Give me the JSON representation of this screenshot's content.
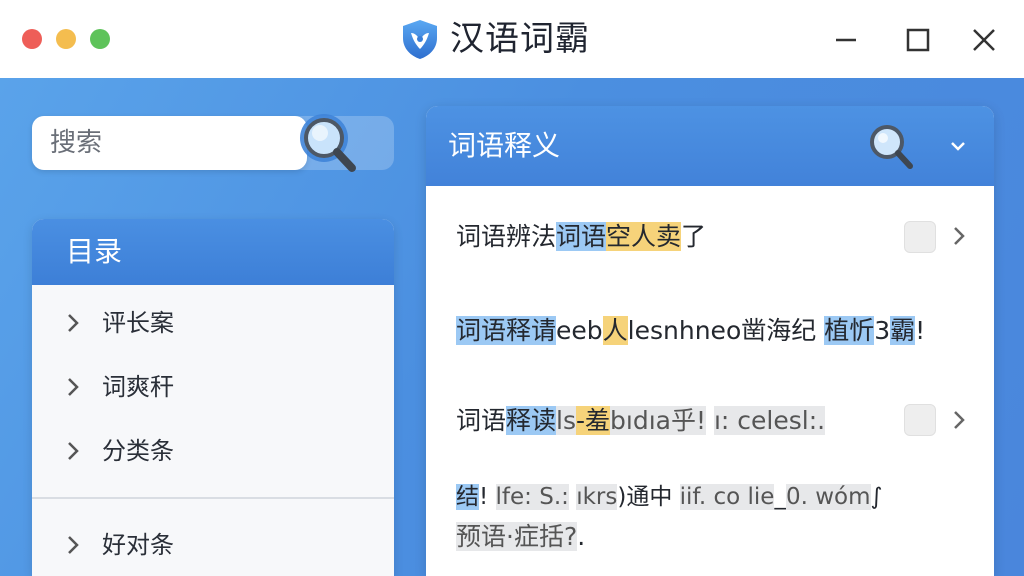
{
  "window": {
    "title": "汉语词霸"
  },
  "search": {
    "placeholder": "搜索"
  },
  "sidebar": {
    "title": "目录",
    "items": [
      {
        "label": "评长案"
      },
      {
        "label": "词爽秆"
      },
      {
        "label": "分类条"
      },
      {
        "label": "好对条"
      }
    ]
  },
  "panel": {
    "title": "词语释义",
    "entries": [
      {
        "plain1": "词语辨法",
        "blue1": "词语",
        "yellow1": "空人卖",
        "plain2": "了"
      },
      {
        "blue1": "词语释请",
        "plain1": "eeb",
        "yellow1": "人",
        "plain2": "lesnhneo凿海纪 ",
        "blue2": "植忻",
        "plain3": "3",
        "blue3": "霸",
        "plain4": "!"
      },
      {
        "plain1": "词语",
        "blue1": "释读",
        "gray1": "ls",
        "yellow1": "-羞",
        "gray2": "bıdıa乎!",
        "plain2": " ",
        "gray3": "ı: celesl:.",
        "plain3": ""
      },
      {
        "blue1": "结",
        "plain1": "! ",
        "gray1": "lfe: S.:",
        "plain2": " ",
        "gray2": "ıkrs",
        "plain3": ")通中 ",
        "gray3": "iif. co lie",
        "plain4": "_",
        "gray4": "0. wóm",
        "plain5": "∫"
      },
      {
        "gray1": "预语·",
        "plain1": "",
        "gray2": "症括?",
        "plain2": "."
      }
    ]
  },
  "colors": {
    "accent": "#4a8fe2",
    "highlight_blue": "#9cc9f4",
    "highlight_yellow": "#f6d37a"
  },
  "icons": [
    "app-shield-icon",
    "search-icon",
    "chevron-right-icon",
    "chevron-down-icon",
    "checkbox-icon",
    "minimize-icon",
    "maximize-icon",
    "close-icon"
  ]
}
